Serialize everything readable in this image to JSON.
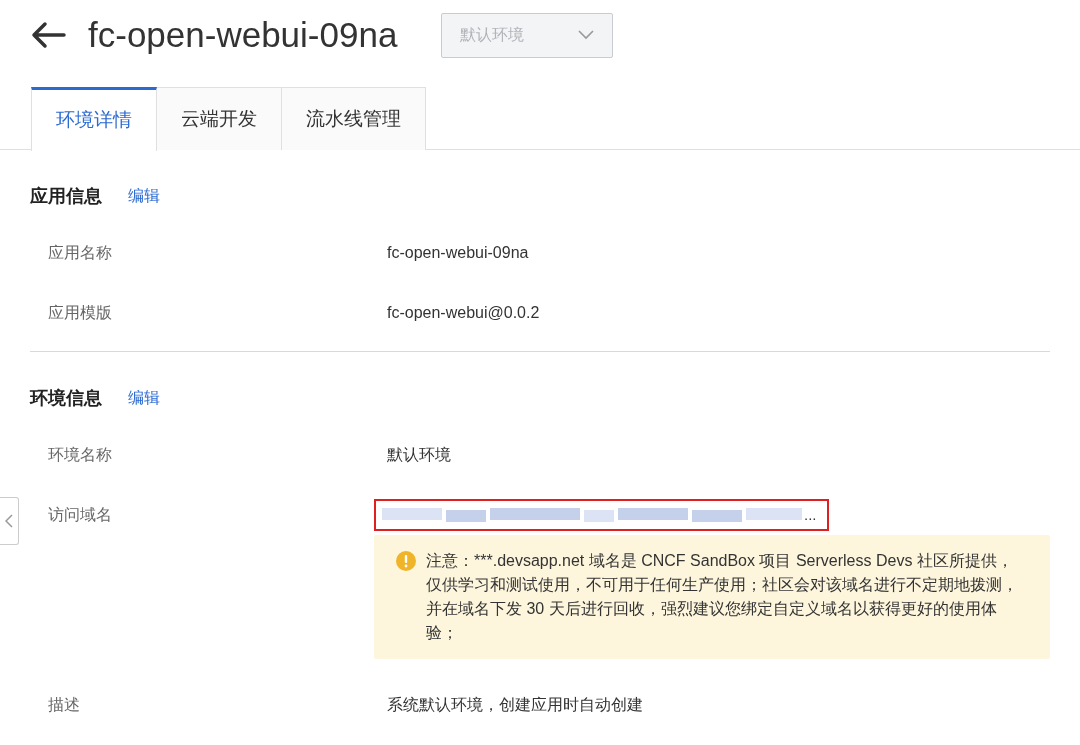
{
  "header": {
    "title": "fc-open-webui-09na",
    "environment_select": {
      "value": "默认环境",
      "disabled": true
    }
  },
  "tabs": [
    {
      "label": "环境详情",
      "selected": true
    },
    {
      "label": "云端开发",
      "selected": false
    },
    {
      "label": "流水线管理",
      "selected": false
    }
  ],
  "sections": [
    {
      "title": "应用信息",
      "edit": "编辑",
      "fields": [
        {
          "kind": "text",
          "label": "应用名称",
          "value": "fc-open-webui-09na"
        },
        {
          "kind": "text",
          "label": "应用模版",
          "value": "fc-open-webui@0.0.2"
        }
      ]
    },
    {
      "title": "环境信息",
      "edit": "编辑",
      "fields": [
        {
          "kind": "text",
          "label": "环境名称",
          "value": "默认环境"
        },
        {
          "kind": "masked",
          "label": "访问域名",
          "value": "...",
          "highlighted": true,
          "notice": "注意：***.devsapp.net 域名是 CNCF SandBox 项目 Serverless Devs 社区所提供，仅供学习和测试使用，不可用于任何生产使用；社区会对该域名进行不定期地拨测，并在域名下发 30 天后进行回收，强烈建议您绑定自定义域名以获得更好的使用体验；"
        },
        {
          "kind": "text",
          "label": "描述",
          "value": "系统默认环境，创建应用时自动创建"
        }
      ]
    }
  ]
}
